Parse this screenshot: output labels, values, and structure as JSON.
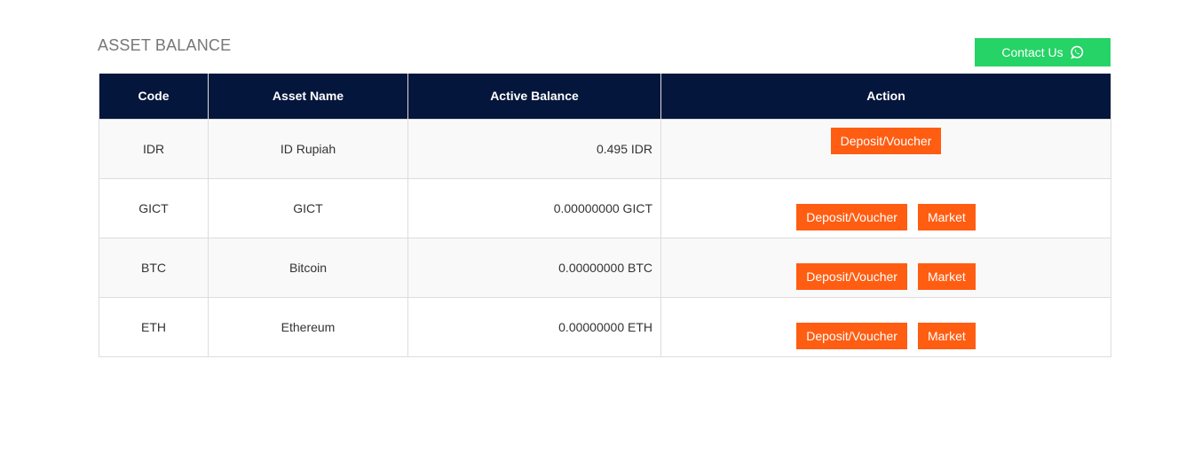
{
  "page": {
    "title": "ASSET BALANCE",
    "contact_label": "Contact Us"
  },
  "colors": {
    "header_bg": "#04163c",
    "action_button": "#ff5d12",
    "contact_button": "#25d366"
  },
  "table": {
    "headers": [
      "Code",
      "Asset Name",
      "Active Balance",
      "Action"
    ],
    "rows": [
      {
        "code": "IDR",
        "name": "ID Rupiah",
        "balance": "0.495 IDR",
        "actions": [
          "Deposit/Voucher"
        ]
      },
      {
        "code": "GICT",
        "name": "GICT",
        "balance": "0.00000000 GICT",
        "actions": [
          "Deposit/Voucher",
          "Market"
        ]
      },
      {
        "code": "BTC",
        "name": "Bitcoin",
        "balance": "0.00000000 BTC",
        "actions": [
          "Deposit/Voucher",
          "Market"
        ]
      },
      {
        "code": "ETH",
        "name": "Ethereum",
        "balance": "0.00000000 ETH",
        "actions": [
          "Deposit/Voucher",
          "Market"
        ]
      }
    ]
  },
  "icons": {
    "contact": "whatsapp-icon"
  }
}
